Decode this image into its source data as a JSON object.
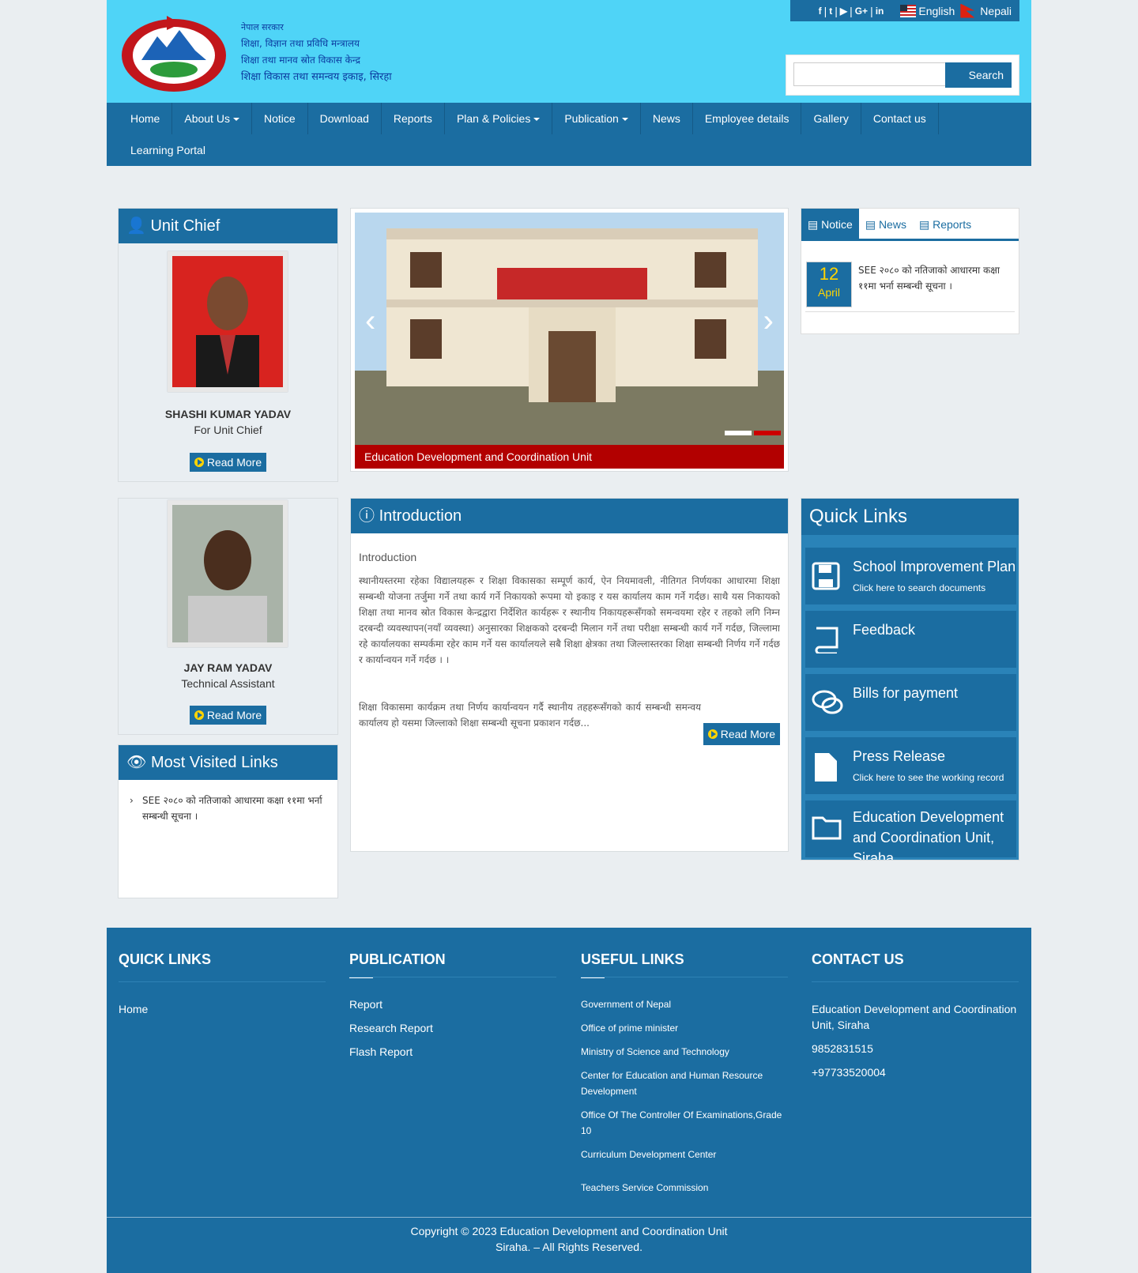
{
  "header": {
    "gov_line1": "नेपाल सरकार",
    "gov_line2": "शिक्षा, विज्ञान तथा प्रविधि मन्त्रालय",
    "gov_line3": "शिक्षा तथा मानव स्रोत विकास केन्द्र",
    "gov_line4": "शिक्षा विकास तथा समन्वय इकाइ, सिरहा",
    "social_icons": [
      "facebook-icon",
      "twitter-icon",
      "youtube-icon",
      "google-plus-icon",
      "linkedin-icon"
    ],
    "lang_english": "English",
    "lang_nepali": "Nepali",
    "search_placeholder": "",
    "search_button": "Search"
  },
  "nav": {
    "items": [
      "Home",
      "About Us",
      "Notice",
      "Download",
      "Reports",
      "Plan & Policies",
      "Publication",
      "News",
      "Employee details",
      "Gallery",
      "Contact us",
      "Learning Portal"
    ]
  },
  "unit_chief": {
    "title": "Unit Chief",
    "name": "SHASHI KUMAR YADAV",
    "role": "For Unit Chief",
    "read_more": "Read More"
  },
  "assistant": {
    "name": "JAY RAM YADAV",
    "role": "Technical Assistant",
    "read_more": "Read More"
  },
  "slider": {
    "caption": "Education Development and Coordination Unit"
  },
  "tabs": {
    "notice": "Notice",
    "news": "News",
    "reports": "Reports",
    "item_day": "12",
    "item_month": "April",
    "item_text": "SEE २०८० को नतिजाको आधारमा कक्षा ११मा भर्ना सम्बन्धी सूचना ।"
  },
  "intro": {
    "title": "Introduction",
    "subtitle": "Introduction",
    "para1": "स्थानीयस्तरमा रहेका विद्यालयहरू र शिक्षा विकासका सम्पूर्ण कार्य, ऐन नियमावली, नीतिगत निर्णयका आधारमा शिक्षा सम्बन्धी योजना तर्जुमा गर्ने तथा कार्य गर्ने निकायको रूपमा यो इकाइ र यस कार्यालय काम गर्ने गर्दछ। साथै यस निकायको शिक्षा तथा मानव स्रोत विकास केन्द्रद्वारा निर्देशित कार्यहरू र स्थानीय निकायहरूसँगको समन्वयमा रहेर र तहको लगि निम्न दरबन्दी व्यवस्थापन(नयाँ व्यवस्था) अनुसारका शिक्षकको दरबन्दी मिलान गर्ने तथा परीक्षा सम्बन्धी कार्य गर्ने गर्दछ, जिल्लामा रहे कार्यालयका सम्पर्कमा रहेर काम गर्ने यस कार्यालयले सबै शिक्षा क्षेत्रका तथा जिल्लास्तरका शिक्षा सम्बन्धी निर्णय गर्ने गर्दछ र कार्यान्वयन गर्ने गर्दछ । ।",
    "para2": "शिक्षा विकासमा कार्यक्रम तथा निर्णय कार्यान्वयन गर्दै स्थानीय तहहरूसँगको कार्य सम्बन्धी समन्वय कार्यालय हो यसमा जिल्लाको शिक्षा सम्बन्धी सूचना प्रकाशन गर्दछ...",
    "read_more": "Read More"
  },
  "most_visited": {
    "title": "Most Visited Links",
    "item": "SEE २०८० को नतिजाको आधारमा कक्षा ११मा भर्ना सम्बन्धी सूचना ।"
  },
  "quick_links": {
    "title": "Quick Links",
    "items": [
      {
        "title": "School Improvement Plan",
        "sub": "Click here to search documents",
        "icon": "floppy-icon"
      },
      {
        "title": "Feedback",
        "sub": "",
        "icon": "book-icon"
      },
      {
        "title": "Bills for payment",
        "sub": "",
        "icon": "comments-icon"
      },
      {
        "title": "Press Release",
        "sub": "Click here to see the working record",
        "icon": "file-icon"
      },
      {
        "title": "Education Development and Coordination Unit, Siraha",
        "sub": "",
        "icon": "folder-icon"
      }
    ]
  },
  "footer": {
    "quick_title": "QUICK LINKS",
    "quick_items": [
      "Home"
    ],
    "pub_title": "PUBLICATION",
    "pub_items": [
      "Report",
      "Research Report",
      "Flash Report"
    ],
    "useful_title": "USEFUL LINKS",
    "useful_items": [
      "Government of Nepal",
      "Office of prime minister",
      "Ministry of Science and Technology",
      "Center for Education and Human Resource Development",
      "Office Of The Controller Of Examinations,Grade 10",
      "Curriculum Development Center",
      "Teachers Service Commission"
    ],
    "contact_title": "CONTACT US",
    "contact_org": "Education Development and Coordination Unit, Siraha",
    "contact_phone1": "9852831515",
    "contact_phone2": "+97733520004",
    "copyright_line1": "Copyright © 2023 Education Development and Coordination Unit",
    "copyright_line2": "Siraha. – All Rights Reserved."
  }
}
